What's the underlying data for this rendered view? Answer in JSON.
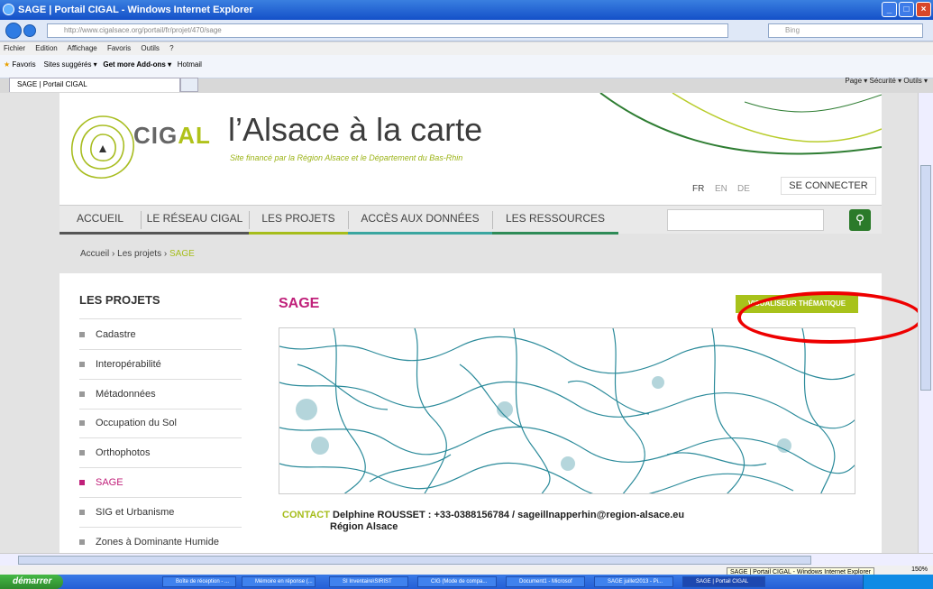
{
  "window": {
    "title": "SAGE | Portail CIGAL - Windows Internet Explorer"
  },
  "browser": {
    "url": "http://www.cigalsace.org/portail/fr/projet/470/sage",
    "search_placeholder": "Bing",
    "menu": [
      "Fichier",
      "Edition",
      "Affichage",
      "Favoris",
      "Outils",
      "?"
    ],
    "favorites": [
      "Favoris",
      "Sites suggérés ▾",
      "Get more Add-ons ▾",
      "Hotmail"
    ],
    "tab_label": "SAGE | Portail CIGAL",
    "tools": "Page ▾  Sécurité ▾  Outils ▾"
  },
  "site": {
    "logo_text": "CIG",
    "logo_accent": "AL",
    "tagline": "l’Alsace à la carte",
    "subtagline": "Site financé par la Région Alsace et le Département du Bas-Rhin",
    "languages": [
      "FR",
      "EN",
      "DE"
    ],
    "login": "SE CONNECTER",
    "nav": [
      "ACCUEIL",
      "LE RÉSEAU CIGAL",
      "LES PROJETS",
      "ACCÈS AUX DONNÉES",
      "LES RESSOURCES"
    ],
    "nav_colors": [
      "#555555",
      "#555555",
      "#a6bd1b",
      "#3aa6a0",
      "#2e8b57"
    ]
  },
  "breadcrumb": {
    "home": "Accueil",
    "sep": "›",
    "section": "Les projets",
    "current": "SAGE"
  },
  "sidebar": {
    "title": "LES PROJETS",
    "items": [
      "Cadastre",
      "Interopérabilité",
      "Métadonnées",
      "Occupation du Sol",
      "Orthophotos",
      "SAGE",
      "SIG et Urbanisme",
      "Zones à Dominante Humide"
    ],
    "active": "SAGE"
  },
  "main": {
    "title": "SAGE",
    "viz_button": "VISUALISEUR THÉMATIQUE",
    "contact_label": "CONTACT",
    "contact_info": "Delphine ROUSSET : +33-0388156784 / sageillnapperhin@region-alsace.eu",
    "contact_org": "Région Alsace"
  },
  "status": {
    "tooltip": "SAGE | Portail CIGAL - Windows Internet Explorer",
    "zoom": "150%"
  },
  "taskbar": {
    "start": "démarrer",
    "items": [
      "Boîte de réception - ...",
      "Mémoire en réponse (...",
      "SI Inventaire\\SIRIST",
      "CIG (Mode de compa...",
      "Document1 - Microsof",
      "SAGE juillet2013 - Pi...",
      "SAGE | Portail CIGAL"
    ]
  },
  "colors": {
    "accent_green": "#a6bd1b",
    "accent_magenta": "#c0207a",
    "map_line": "#2a8a9a"
  }
}
